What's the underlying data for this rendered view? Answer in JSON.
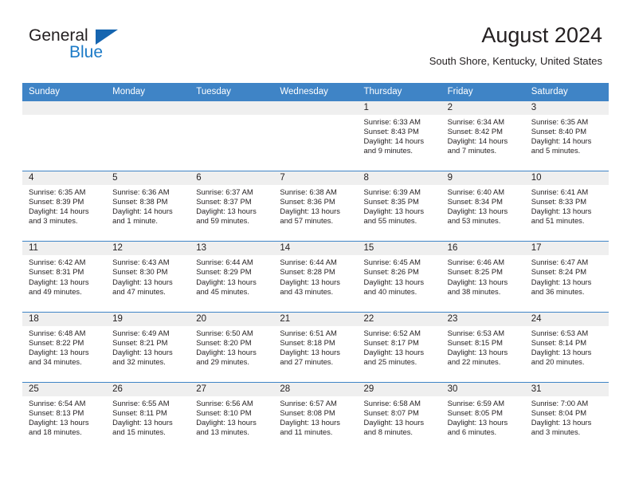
{
  "brand": {
    "name_part1": "General",
    "name_part2": "Blue",
    "triangle_color": "#1565b0",
    "blue_color": "#1b7ac7"
  },
  "header": {
    "title": "August 2024",
    "subtitle": "South Shore, Kentucky, United States"
  },
  "theme": {
    "header_bar": "#3f84c6",
    "day_band": "#efefef",
    "text": "#231f20"
  },
  "weekdays": [
    "Sunday",
    "Monday",
    "Tuesday",
    "Wednesday",
    "Thursday",
    "Friday",
    "Saturday"
  ],
  "weeks": [
    [
      {
        "day": "",
        "sunrise": "",
        "sunset": "",
        "daylight": ""
      },
      {
        "day": "",
        "sunrise": "",
        "sunset": "",
        "daylight": ""
      },
      {
        "day": "",
        "sunrise": "",
        "sunset": "",
        "daylight": ""
      },
      {
        "day": "",
        "sunrise": "",
        "sunset": "",
        "daylight": ""
      },
      {
        "day": "1",
        "sunrise": "Sunrise: 6:33 AM",
        "sunset": "Sunset: 8:43 PM",
        "daylight": "Daylight: 14 hours and 9 minutes."
      },
      {
        "day": "2",
        "sunrise": "Sunrise: 6:34 AM",
        "sunset": "Sunset: 8:42 PM",
        "daylight": "Daylight: 14 hours and 7 minutes."
      },
      {
        "day": "3",
        "sunrise": "Sunrise: 6:35 AM",
        "sunset": "Sunset: 8:40 PM",
        "daylight": "Daylight: 14 hours and 5 minutes."
      }
    ],
    [
      {
        "day": "4",
        "sunrise": "Sunrise: 6:35 AM",
        "sunset": "Sunset: 8:39 PM",
        "daylight": "Daylight: 14 hours and 3 minutes."
      },
      {
        "day": "5",
        "sunrise": "Sunrise: 6:36 AM",
        "sunset": "Sunset: 8:38 PM",
        "daylight": "Daylight: 14 hours and 1 minute."
      },
      {
        "day": "6",
        "sunrise": "Sunrise: 6:37 AM",
        "sunset": "Sunset: 8:37 PM",
        "daylight": "Daylight: 13 hours and 59 minutes."
      },
      {
        "day": "7",
        "sunrise": "Sunrise: 6:38 AM",
        "sunset": "Sunset: 8:36 PM",
        "daylight": "Daylight: 13 hours and 57 minutes."
      },
      {
        "day": "8",
        "sunrise": "Sunrise: 6:39 AM",
        "sunset": "Sunset: 8:35 PM",
        "daylight": "Daylight: 13 hours and 55 minutes."
      },
      {
        "day": "9",
        "sunrise": "Sunrise: 6:40 AM",
        "sunset": "Sunset: 8:34 PM",
        "daylight": "Daylight: 13 hours and 53 minutes."
      },
      {
        "day": "10",
        "sunrise": "Sunrise: 6:41 AM",
        "sunset": "Sunset: 8:33 PM",
        "daylight": "Daylight: 13 hours and 51 minutes."
      }
    ],
    [
      {
        "day": "11",
        "sunrise": "Sunrise: 6:42 AM",
        "sunset": "Sunset: 8:31 PM",
        "daylight": "Daylight: 13 hours and 49 minutes."
      },
      {
        "day": "12",
        "sunrise": "Sunrise: 6:43 AM",
        "sunset": "Sunset: 8:30 PM",
        "daylight": "Daylight: 13 hours and 47 minutes."
      },
      {
        "day": "13",
        "sunrise": "Sunrise: 6:44 AM",
        "sunset": "Sunset: 8:29 PM",
        "daylight": "Daylight: 13 hours and 45 minutes."
      },
      {
        "day": "14",
        "sunrise": "Sunrise: 6:44 AM",
        "sunset": "Sunset: 8:28 PM",
        "daylight": "Daylight: 13 hours and 43 minutes."
      },
      {
        "day": "15",
        "sunrise": "Sunrise: 6:45 AM",
        "sunset": "Sunset: 8:26 PM",
        "daylight": "Daylight: 13 hours and 40 minutes."
      },
      {
        "day": "16",
        "sunrise": "Sunrise: 6:46 AM",
        "sunset": "Sunset: 8:25 PM",
        "daylight": "Daylight: 13 hours and 38 minutes."
      },
      {
        "day": "17",
        "sunrise": "Sunrise: 6:47 AM",
        "sunset": "Sunset: 8:24 PM",
        "daylight": "Daylight: 13 hours and 36 minutes."
      }
    ],
    [
      {
        "day": "18",
        "sunrise": "Sunrise: 6:48 AM",
        "sunset": "Sunset: 8:22 PM",
        "daylight": "Daylight: 13 hours and 34 minutes."
      },
      {
        "day": "19",
        "sunrise": "Sunrise: 6:49 AM",
        "sunset": "Sunset: 8:21 PM",
        "daylight": "Daylight: 13 hours and 32 minutes."
      },
      {
        "day": "20",
        "sunrise": "Sunrise: 6:50 AM",
        "sunset": "Sunset: 8:20 PM",
        "daylight": "Daylight: 13 hours and 29 minutes."
      },
      {
        "day": "21",
        "sunrise": "Sunrise: 6:51 AM",
        "sunset": "Sunset: 8:18 PM",
        "daylight": "Daylight: 13 hours and 27 minutes."
      },
      {
        "day": "22",
        "sunrise": "Sunrise: 6:52 AM",
        "sunset": "Sunset: 8:17 PM",
        "daylight": "Daylight: 13 hours and 25 minutes."
      },
      {
        "day": "23",
        "sunrise": "Sunrise: 6:53 AM",
        "sunset": "Sunset: 8:15 PM",
        "daylight": "Daylight: 13 hours and 22 minutes."
      },
      {
        "day": "24",
        "sunrise": "Sunrise: 6:53 AM",
        "sunset": "Sunset: 8:14 PM",
        "daylight": "Daylight: 13 hours and 20 minutes."
      }
    ],
    [
      {
        "day": "25",
        "sunrise": "Sunrise: 6:54 AM",
        "sunset": "Sunset: 8:13 PM",
        "daylight": "Daylight: 13 hours and 18 minutes."
      },
      {
        "day": "26",
        "sunrise": "Sunrise: 6:55 AM",
        "sunset": "Sunset: 8:11 PM",
        "daylight": "Daylight: 13 hours and 15 minutes."
      },
      {
        "day": "27",
        "sunrise": "Sunrise: 6:56 AM",
        "sunset": "Sunset: 8:10 PM",
        "daylight": "Daylight: 13 hours and 13 minutes."
      },
      {
        "day": "28",
        "sunrise": "Sunrise: 6:57 AM",
        "sunset": "Sunset: 8:08 PM",
        "daylight": "Daylight: 13 hours and 11 minutes."
      },
      {
        "day": "29",
        "sunrise": "Sunrise: 6:58 AM",
        "sunset": "Sunset: 8:07 PM",
        "daylight": "Daylight: 13 hours and 8 minutes."
      },
      {
        "day": "30",
        "sunrise": "Sunrise: 6:59 AM",
        "sunset": "Sunset: 8:05 PM",
        "daylight": "Daylight: 13 hours and 6 minutes."
      },
      {
        "day": "31",
        "sunrise": "Sunrise: 7:00 AM",
        "sunset": "Sunset: 8:04 PM",
        "daylight": "Daylight: 13 hours and 3 minutes."
      }
    ]
  ]
}
